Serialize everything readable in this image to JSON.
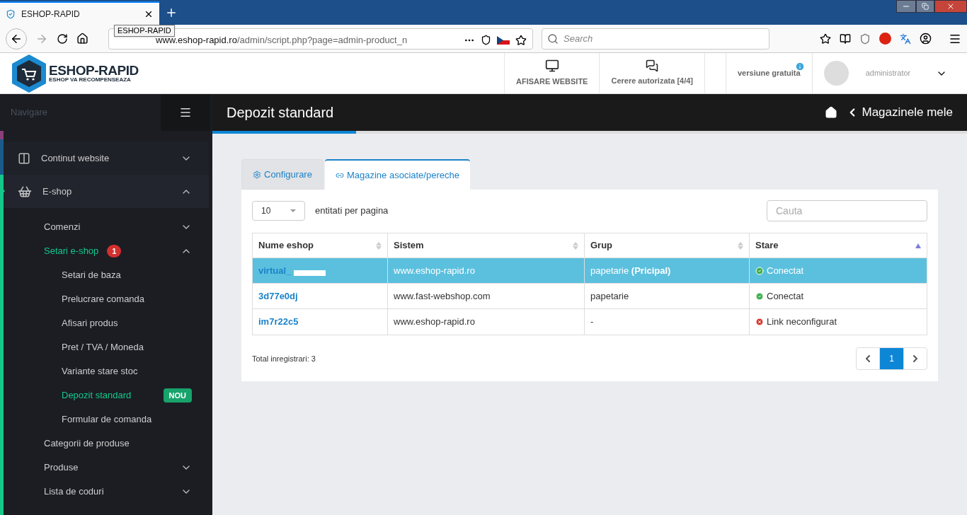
{
  "browser": {
    "tab_title": "ESHOP-RAPID",
    "tooltip": "ESHOP-RAPID",
    "url_host": "www.eshop-rapid.ro",
    "url_path": "/admin/script.php?page=admin-product_n",
    "search_placeholder": "Search"
  },
  "header": {
    "logo_title": "ESHOP-RAPID",
    "logo_subtitle": "ESHOP VA RECOMPENSEAZA",
    "actions": [
      {
        "kind": "monitor",
        "label": "AFISARE WEBSITE"
      },
      {
        "kind": "chat",
        "label": "Cerere autorizata [4/4]"
      }
    ],
    "version": "versiune gratuita",
    "user": "administrator"
  },
  "sidebar": {
    "nav_label": "Navigare",
    "items": [
      {
        "kind": "website",
        "label": "Continut website",
        "selected": false,
        "expanded": false
      },
      {
        "kind": "shop",
        "label": "E-shop",
        "selected": true,
        "expanded": true,
        "children": [
          {
            "label": "Comenzi",
            "selected": false,
            "expanded": false
          },
          {
            "label": "Setari e-shop",
            "selected": true,
            "expanded": true,
            "badge": "1",
            "children": [
              {
                "label": "Setari de baza",
                "selected": false
              },
              {
                "label": "Prelucrare comanda",
                "selected": false
              },
              {
                "label": "Afisari produs",
                "selected": false
              },
              {
                "label": "Pret / TVA / Moneda",
                "selected": false
              },
              {
                "label": "Variante stare stoc",
                "selected": false
              },
              {
                "label": "Depozit standard",
                "selected": true,
                "tag": "NOU"
              },
              {
                "label": "Formular de comanda",
                "selected": false
              }
            ]
          },
          {
            "label": "Categorii de produse",
            "selected": false
          },
          {
            "label": "Produse",
            "selected": false,
            "expanded": false
          },
          {
            "label": "Lista de coduri",
            "selected": false,
            "expanded": false
          }
        ]
      }
    ]
  },
  "page": {
    "title": "Depozit standard",
    "breadcrumb": "Magazinele mele"
  },
  "tabs": [
    {
      "kind": "gears",
      "label": "Configurare",
      "selected": false
    },
    {
      "kind": "link",
      "label": "Magazine asociate/pereche",
      "selected": true
    }
  ],
  "per_page": {
    "value": "10",
    "label": "entitati per pagina"
  },
  "search": {
    "placeholder": "Cauta"
  },
  "table": {
    "columns": [
      {
        "label": "Nume eshop",
        "sorted": false
      },
      {
        "label": "Sistem",
        "sorted": false
      },
      {
        "label": "Grup",
        "sorted": false
      },
      {
        "label": "Stare",
        "sorted": true
      }
    ],
    "rows": [
      {
        "name": "virtual_",
        "system": "www.eshop-rapid.ro",
        "group": "papetarie **(Pricipal)**",
        "status": "Conectat",
        "ok": true,
        "selected": true
      },
      {
        "name": "3d77e0dj",
        "system": "www.fast-webshop.com",
        "group": "papetarie",
        "status": "Conectat",
        "ok": true,
        "selected": false
      },
      {
        "name": "im7r22c5",
        "system": "www.eshop-rapid.ro",
        "group": "-",
        "status": "Link neconfigurat",
        "ok": false,
        "selected": false
      }
    ]
  },
  "total": "Total inregistrari: 3",
  "pagination": [
    {
      "label": "1",
      "selected": true
    }
  ]
}
